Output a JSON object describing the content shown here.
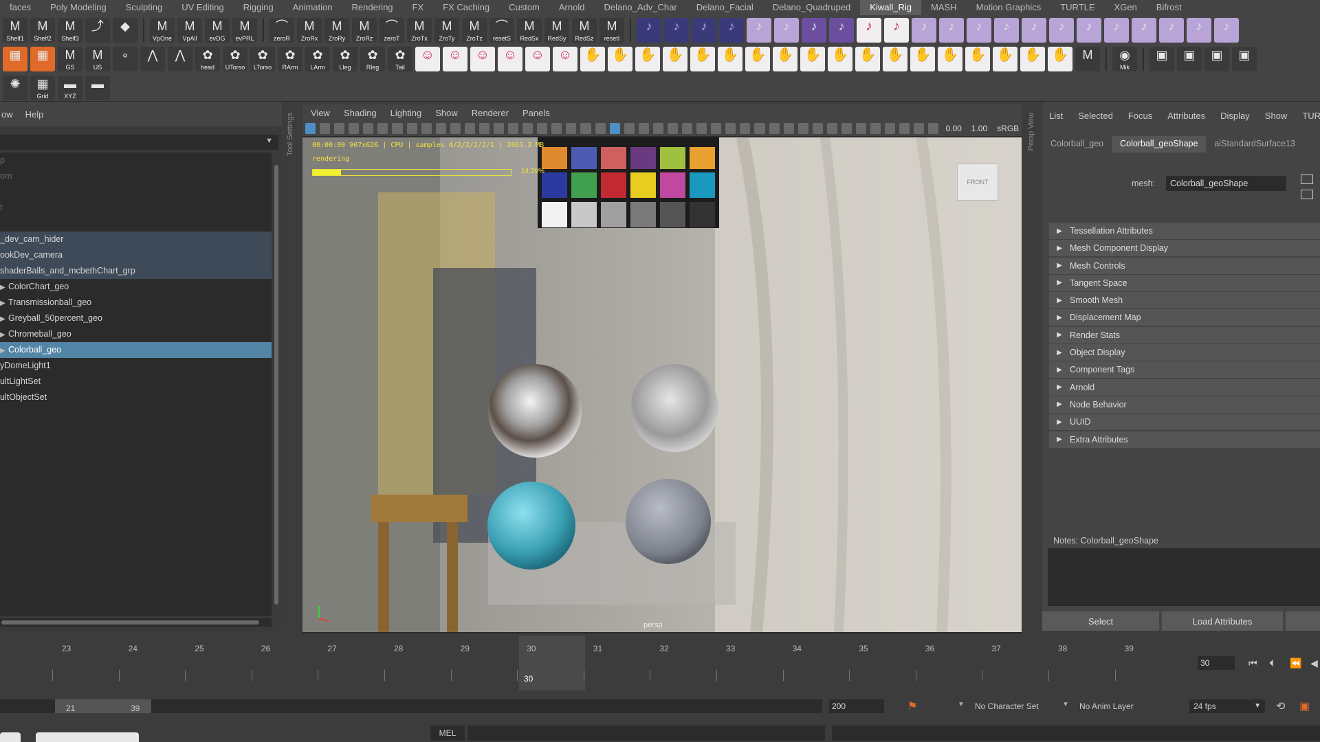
{
  "shelf_tabs": [
    "faces",
    "Poly Modeling",
    "Sculpting",
    "UV Editing",
    "Rigging",
    "Animation",
    "Rendering",
    "FX",
    "FX Caching",
    "Custom",
    "Arnold",
    "Delano_Adv_Char",
    "Delano_Facial",
    "Delano_Quadruped",
    "Kiwall_Rig",
    "MASH",
    "Motion Graphics",
    "TURTLE",
    "XGen",
    "Bifrost"
  ],
  "shelf_active_tab": "Kiwall_Rig",
  "shelf": {
    "row1_text": [
      "Shelf1",
      "Shelf2",
      "Shelf3",
      "VpOne",
      "VpAll",
      "evDG",
      "evPRL",
      "zeroR",
      "ZroRx",
      "ZroRy",
      "ZroRz",
      "zeroT",
      "ZroTx",
      "ZroTy",
      "ZroTz",
      "resetS",
      "RedSx",
      "RedSy",
      "RedSz",
      "resetI"
    ],
    "row2_text": [
      "GS",
      "US",
      "head",
      "UTorso",
      "LTorso",
      "RArm",
      "LArm",
      "Lleg",
      "Rleg",
      "Tail"
    ],
    "row2_right": [
      "Mik",
      "Mik"
    ],
    "row3_text": [
      "Grid",
      "XYZ"
    ]
  },
  "outliner": {
    "menu": [
      "ow",
      "Help"
    ],
    "rows": [
      {
        "label": "p",
        "style": "dim",
        "expand": false
      },
      {
        "label": "om",
        "style": "dim",
        "expand": false
      },
      {
        "label": "",
        "style": "dim",
        "expand": false
      },
      {
        "label": "t",
        "style": "dim",
        "expand": false
      },
      {
        "label": "",
        "style": "dim",
        "expand": false
      },
      {
        "label": "_dev_cam_hider",
        "style": "hl",
        "expand": false
      },
      {
        "label": "ookDev_camera",
        "style": "hl",
        "expand": false
      },
      {
        "label": "shaderBalls_and_mcbethChart_grp",
        "style": "hl",
        "expand": false
      },
      {
        "label": "ColorChart_geo",
        "style": "",
        "expand": true
      },
      {
        "label": "Transmissionball_geo",
        "style": "",
        "expand": true
      },
      {
        "label": "Greyball_50percent_geo",
        "style": "",
        "expand": true
      },
      {
        "label": "Chromeball_geo",
        "style": "",
        "expand": true
      },
      {
        "label": "Colorball_geo",
        "style": "sel",
        "expand": true
      },
      {
        "label": "yDomeLight1",
        "style": "",
        "expand": false
      },
      {
        "label": "ultLightSet",
        "style": "",
        "expand": false
      },
      {
        "label": "ultObjectSet",
        "style": "",
        "expand": false
      }
    ]
  },
  "side_labels": {
    "tool_settings": "Tool Settings",
    "persp_view": "Persp View"
  },
  "viewport": {
    "menu": [
      "View",
      "Shading",
      "Lighting",
      "Show",
      "Renderer",
      "Panels"
    ],
    "toolbar_values": {
      "exposure": "0.00",
      "gamma": "1.00",
      "colorspace": "sRGB"
    },
    "hud_line1": "00:00:00 907x626 | CPU | samples 4/2/2/2/2/1 | 3063.3 MB",
    "hud_line2": "rendering",
    "progress_percent": 14.29,
    "progress_label": "14.29%",
    "camera_label": "persp",
    "viewcube_label": "FRONT"
  },
  "color_chart": {
    "colors": [
      "#e08a30",
      "#4f5bb0",
      "#d06060",
      "#6a3a80",
      "#a0c040",
      "#e8a030",
      "#2a3aa0",
      "#40a050",
      "#c02a30",
      "#e8cc20",
      "#c048a0",
      "#1a98c0",
      "#f2f2f2",
      "#c8c8c8",
      "#a0a0a0",
      "#7a7a7a",
      "#555555",
      "#333333"
    ]
  },
  "attribute_editor": {
    "menu": [
      "List",
      "Selected",
      "Focus",
      "Attributes",
      "Display",
      "Show",
      "TURTLE"
    ],
    "tabs": [
      "Colorball_geo",
      "Colorball_geoShape",
      "aiStandardSurface13"
    ],
    "active_tab": 1,
    "mesh_label": "mesh:",
    "mesh_value": "Colorball_geoShape",
    "sections": [
      "Tessellation Attributes",
      "Mesh Component Display",
      "Mesh Controls",
      "Tangent Space",
      "Smooth Mesh",
      "Displacement Map",
      "Render Stats",
      "Object Display",
      "Component Tags",
      "Arnold",
      "Node Behavior",
      "UUID",
      "Extra Attributes"
    ],
    "notes_label": "Notes:  Colorball_geoShape",
    "buttons": {
      "select": "Select",
      "load": "Load Attributes"
    }
  },
  "timeline": {
    "ticks": [
      "23",
      "24",
      "25",
      "26",
      "27",
      "28",
      "29",
      "30",
      "31",
      "32",
      "33",
      "34",
      "35",
      "36",
      "37",
      "38",
      "39"
    ],
    "current_frame": "30",
    "frame_field": "30"
  },
  "range": {
    "start_inner": "21",
    "end_inner": "39",
    "end_outer": "200",
    "character_set": "No Character Set",
    "anim_layer": "No Anim Layer",
    "fps": "24 fps"
  },
  "command_line": {
    "mode": "MEL"
  }
}
